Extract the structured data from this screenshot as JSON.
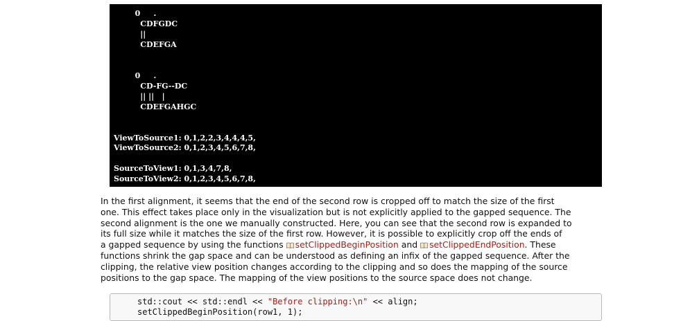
{
  "terminal": {
    "lines": [
      "        0     .",
      "          CDFGDC",
      "          ||",
      "          CDEFGA",
      "",
      "",
      "        0     .",
      "          CD-FG--DC",
      "          || ||   |",
      "          CDEFGAHGC",
      "",
      "",
      "ViewToSource1: 0,1,2,2,3,4,4,4,5,",
      "ViewToSource2: 0,1,2,3,4,5,6,7,8,",
      "",
      "SourceToView1: 0,1,3,4,7,8,",
      "SourceToView2: 0,1,2,3,4,5,6,7,8,"
    ]
  },
  "paragraph": {
    "line1": "In the first alignment, it seems that the end of the second row is cropped off to match the size of the first",
    "line2": "one. This effect takes place only in the visualization but is not explicitly applied to the gapped sequence. The",
    "line3": "second alignment is the one we manually constructed. Here, you can see that the second row is expanded to",
    "line4": "its full size while it matches the size of the first row. However, it is possible to explicitly crop off the ends of",
    "line5_pre": "a gapped sequence by using the functions ",
    "link1": "setClippedBeginPosition",
    "line5_mid": " and ",
    "link2": "setClippedEndPosition",
    "line5_post": ". These",
    "line6": "functions shrink the gap space and can be understood as defining an infix of the gapped sequence. After the",
    "line7": "clipping, the relative view position changes according to the clipping and so does the mapping of the source",
    "line8": "positions to the gap space. The mapping of the view positions to the source space does not change.",
    "link_icon": "book-icon",
    "link_color": "#b11a12"
  },
  "code": {
    "line1_pre": "std::cout << std::endl << ",
    "line1_str": "\"Before clipping:\\n\"",
    "line1_post": " << align;",
    "line2": "setClippedBeginPosition(row1, 1);"
  }
}
